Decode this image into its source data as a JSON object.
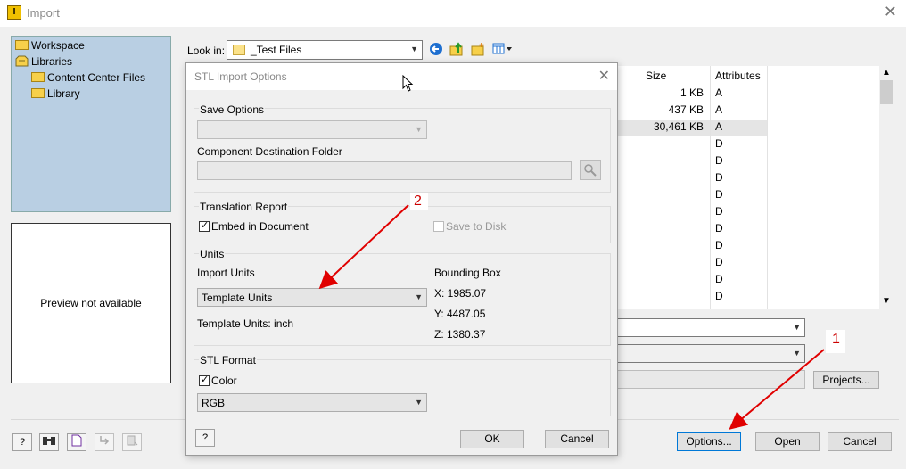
{
  "window": {
    "title": "Import"
  },
  "locations": {
    "items": [
      {
        "label": "Workspace"
      },
      {
        "label": "Libraries"
      },
      {
        "label": "Content Center Files"
      },
      {
        "label": "Library"
      }
    ]
  },
  "preview": {
    "text": "Preview not available"
  },
  "lookin": {
    "label": "Look in:",
    "value": "_Test Files"
  },
  "filelist": {
    "columns": {
      "size": "Size",
      "attributes": "Attributes"
    },
    "rows": [
      {
        "size": "1 KB",
        "attr": "A"
      },
      {
        "size": "437 KB",
        "attr": "A"
      },
      {
        "size": "30,461 KB",
        "attr": "A"
      },
      {
        "size": "",
        "attr": "D"
      },
      {
        "size": "",
        "attr": "D"
      },
      {
        "size": "",
        "attr": "D"
      },
      {
        "size": "",
        "attr": "D"
      },
      {
        "size": "",
        "attr": "D"
      },
      {
        "size": "",
        "attr": "D"
      },
      {
        "size": "",
        "attr": "D"
      },
      {
        "size": "",
        "attr": "D"
      },
      {
        "size": "",
        "attr": "D"
      },
      {
        "size": "",
        "attr": "D"
      }
    ]
  },
  "buttons": {
    "projects": "Projects...",
    "options": "Options...",
    "open": "Open",
    "cancel": "Cancel"
  },
  "dialog": {
    "title": "STL Import Options",
    "save_options": {
      "group": "Save Options",
      "value": ""
    },
    "destination": {
      "label": "Component Destination Folder",
      "value": ""
    },
    "translation_report": {
      "group": "Translation Report",
      "embed": "Embed in Document",
      "save_to_disk": "Save to Disk"
    },
    "units": {
      "group": "Units",
      "import_units_label": "Import Units",
      "import_units_value": "Template Units",
      "template_units": "Template Units: inch",
      "bbox_label": "Bounding Box",
      "bbox_x": "X: 1985.07",
      "bbox_y": "Y: 4487.05",
      "bbox_z": "Z: 1380.37"
    },
    "stl_format": {
      "group": "STL Format",
      "color_label": "Color",
      "color_value": "RGB"
    },
    "ok": "OK",
    "cancel": "Cancel"
  },
  "annotations": {
    "one": "1",
    "two": "2"
  },
  "colors": {
    "annotation": "#e00000",
    "selection": "#e5e5e5",
    "locations_bg": "#b9cfe3"
  }
}
